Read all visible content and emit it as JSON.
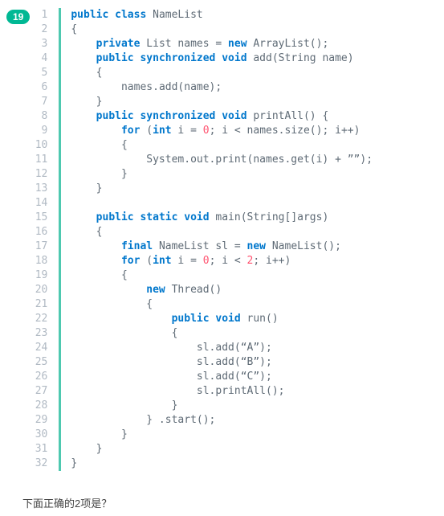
{
  "badge": "19",
  "code": {
    "lines": [
      {
        "n": 1,
        "tokens": [
          {
            "t": "public",
            "c": "kw"
          },
          {
            "t": " ",
            "c": "id"
          },
          {
            "t": "class",
            "c": "kw"
          },
          {
            "t": " NameList",
            "c": "id"
          }
        ],
        "indent": 0
      },
      {
        "n": 2,
        "tokens": [
          {
            "t": "{",
            "c": "id"
          }
        ],
        "indent": 0
      },
      {
        "n": 3,
        "tokens": [
          {
            "t": "private",
            "c": "kw"
          },
          {
            "t": " List names = ",
            "c": "id"
          },
          {
            "t": "new",
            "c": "kw"
          },
          {
            "t": " ArrayList();",
            "c": "id"
          }
        ],
        "indent": 1
      },
      {
        "n": 4,
        "tokens": [
          {
            "t": "public",
            "c": "kw"
          },
          {
            "t": " ",
            "c": "id"
          },
          {
            "t": "synchronized",
            "c": "kw"
          },
          {
            "t": " ",
            "c": "id"
          },
          {
            "t": "void",
            "c": "kw"
          },
          {
            "t": " add(String name)",
            "c": "id"
          }
        ],
        "indent": 1
      },
      {
        "n": 5,
        "tokens": [
          {
            "t": "{",
            "c": "id"
          }
        ],
        "indent": 1
      },
      {
        "n": 6,
        "tokens": [
          {
            "t": "names.add(name);",
            "c": "id"
          }
        ],
        "indent": 2
      },
      {
        "n": 7,
        "tokens": [
          {
            "t": "}",
            "c": "id"
          }
        ],
        "indent": 1
      },
      {
        "n": 8,
        "tokens": [
          {
            "t": "public",
            "c": "kw"
          },
          {
            "t": " ",
            "c": "id"
          },
          {
            "t": "synchronized",
            "c": "kw"
          },
          {
            "t": " ",
            "c": "id"
          },
          {
            "t": "void",
            "c": "kw"
          },
          {
            "t": " printAll() {",
            "c": "id"
          }
        ],
        "indent": 1
      },
      {
        "n": 9,
        "tokens": [
          {
            "t": "for",
            "c": "kw"
          },
          {
            "t": " (",
            "c": "id"
          },
          {
            "t": "int",
            "c": "kw"
          },
          {
            "t": " i = ",
            "c": "id"
          },
          {
            "t": "0",
            "c": "num"
          },
          {
            "t": "; i < names.size(); i++)",
            "c": "id"
          }
        ],
        "indent": 2
      },
      {
        "n": 10,
        "tokens": [
          {
            "t": "{",
            "c": "id"
          }
        ],
        "indent": 2
      },
      {
        "n": 11,
        "tokens": [
          {
            "t": "System.out.print(names.get(i) + ””);",
            "c": "id"
          }
        ],
        "indent": 3
      },
      {
        "n": 12,
        "tokens": [
          {
            "t": "}",
            "c": "id"
          }
        ],
        "indent": 2
      },
      {
        "n": 13,
        "tokens": [
          {
            "t": "}",
            "c": "id"
          }
        ],
        "indent": 1
      },
      {
        "n": 14,
        "tokens": [],
        "indent": 0
      },
      {
        "n": 15,
        "tokens": [
          {
            "t": "public",
            "c": "kw"
          },
          {
            "t": " ",
            "c": "id"
          },
          {
            "t": "static",
            "c": "kw"
          },
          {
            "t": " ",
            "c": "id"
          },
          {
            "t": "void",
            "c": "kw"
          },
          {
            "t": " main(String[]args)",
            "c": "id"
          }
        ],
        "indent": 1
      },
      {
        "n": 16,
        "tokens": [
          {
            "t": "{",
            "c": "id"
          }
        ],
        "indent": 1
      },
      {
        "n": 17,
        "tokens": [
          {
            "t": "final",
            "c": "kw"
          },
          {
            "t": " NameList sl = ",
            "c": "id"
          },
          {
            "t": "new",
            "c": "kw"
          },
          {
            "t": " NameList();",
            "c": "id"
          }
        ],
        "indent": 2
      },
      {
        "n": 18,
        "tokens": [
          {
            "t": "for",
            "c": "kw"
          },
          {
            "t": " (",
            "c": "id"
          },
          {
            "t": "int",
            "c": "kw"
          },
          {
            "t": " i = ",
            "c": "id"
          },
          {
            "t": "0",
            "c": "num"
          },
          {
            "t": "; i < ",
            "c": "id"
          },
          {
            "t": "2",
            "c": "num"
          },
          {
            "t": "; i++)",
            "c": "id"
          }
        ],
        "indent": 2
      },
      {
        "n": 19,
        "tokens": [
          {
            "t": "{",
            "c": "id"
          }
        ],
        "indent": 2
      },
      {
        "n": 20,
        "tokens": [
          {
            "t": "new",
            "c": "kw"
          },
          {
            "t": " Thread()",
            "c": "id"
          }
        ],
        "indent": 3
      },
      {
        "n": 21,
        "tokens": [
          {
            "t": "{",
            "c": "id"
          }
        ],
        "indent": 3
      },
      {
        "n": 22,
        "tokens": [
          {
            "t": "public",
            "c": "kw"
          },
          {
            "t": " ",
            "c": "id"
          },
          {
            "t": "void",
            "c": "kw"
          },
          {
            "t": " run()",
            "c": "id"
          }
        ],
        "indent": 4
      },
      {
        "n": 23,
        "tokens": [
          {
            "t": "{",
            "c": "id"
          }
        ],
        "indent": 4
      },
      {
        "n": 24,
        "tokens": [
          {
            "t": "sl.add(“A”);",
            "c": "id"
          }
        ],
        "indent": 5
      },
      {
        "n": 25,
        "tokens": [
          {
            "t": "sl.add(“B”);",
            "c": "id"
          }
        ],
        "indent": 5
      },
      {
        "n": 26,
        "tokens": [
          {
            "t": "sl.add(“C”);",
            "c": "id"
          }
        ],
        "indent": 5
      },
      {
        "n": 27,
        "tokens": [
          {
            "t": "sl.printAll();",
            "c": "id"
          }
        ],
        "indent": 5
      },
      {
        "n": 28,
        "tokens": [
          {
            "t": "}",
            "c": "id"
          }
        ],
        "indent": 4
      },
      {
        "n": 29,
        "tokens": [
          {
            "t": "} .start();",
            "c": "id"
          }
        ],
        "indent": 3
      },
      {
        "n": 30,
        "tokens": [
          {
            "t": "}",
            "c": "id"
          }
        ],
        "indent": 2
      },
      {
        "n": 31,
        "tokens": [
          {
            "t": "}",
            "c": "id"
          }
        ],
        "indent": 1
      },
      {
        "n": 32,
        "tokens": [
          {
            "t": "}",
            "c": "id"
          }
        ],
        "indent": 0
      }
    ]
  },
  "question": "下面正确的2项是？"
}
